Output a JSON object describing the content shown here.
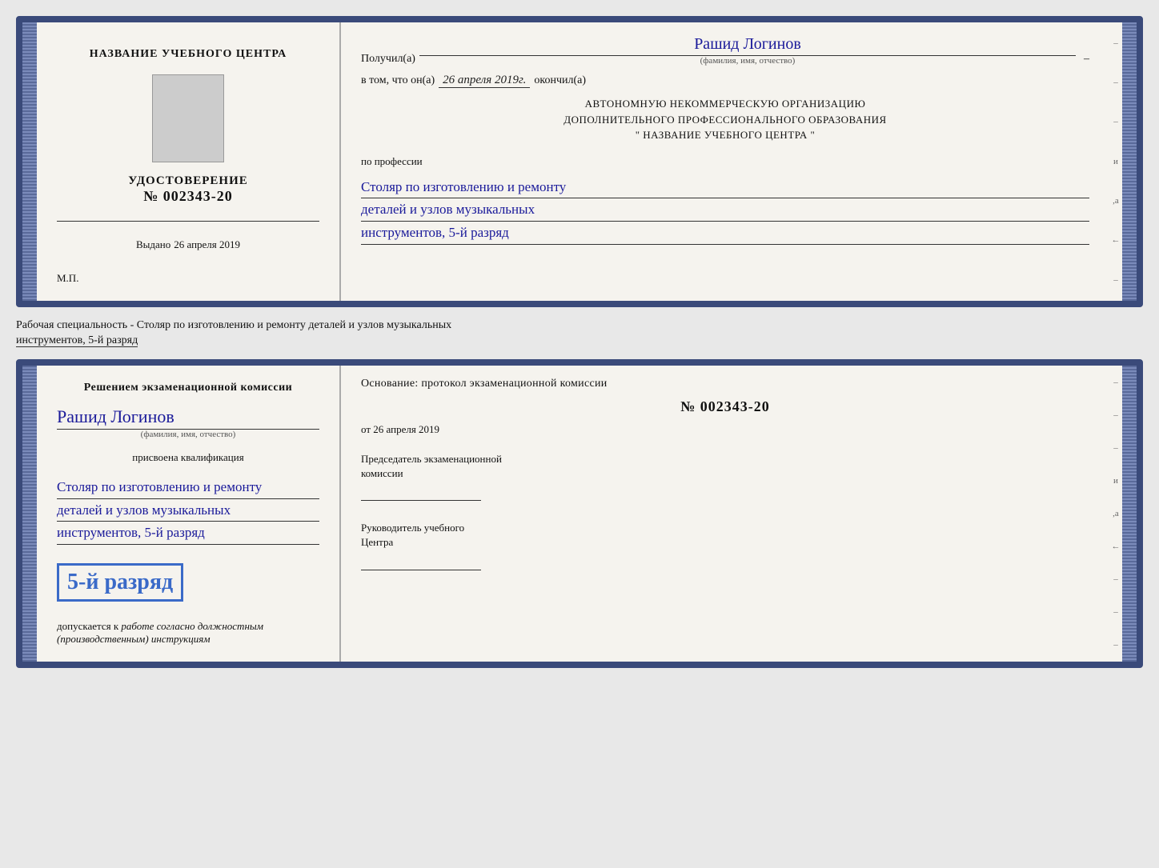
{
  "top_document": {
    "left": {
      "center_name_label": "НАЗВАНИЕ УЧЕБНОГО ЦЕНТРА",
      "udostoverenie_title": "УДОСТОВЕРЕНИЕ",
      "number_prefix": "№",
      "number": "002343-20",
      "vydano_label": "Выдано",
      "vydano_date": "26 апреля 2019",
      "mp_label": "М.П."
    },
    "right": {
      "poluchil_label": "Получил(а)",
      "recipient_name": "Рашид Логинов",
      "fio_subtitle": "(фамилия, имя, отчество)",
      "dash": "–",
      "vtom_prefix": "в том, что он(а)",
      "vtom_date": "26 апреля 2019г.",
      "okonchil_label": "окончил(а)",
      "org_line1": "АВТОНОМНУЮ НЕКОММЕРЧЕСКУЮ ОРГАНИЗАЦИЮ",
      "org_line2": "ДОПОЛНИТЕЛЬНОГО ПРОФЕССИОНАЛЬНОГО ОБРАЗОВАНИЯ",
      "org_line3": "\" НАЗВАНИЕ УЧЕБНОГО ЦЕНТРА \"",
      "po_professii": "по профессии",
      "profession_line1": "Столяр по изготовлению и ремонту",
      "profession_line2": "деталей и узлов музыкальных",
      "profession_line3": "инструментов, 5-й разряд"
    }
  },
  "specialty_label": {
    "prefix": "Рабочая специальность - Столяр по изготовлению и ремонту деталей и узлов музыкальных",
    "line2": "инструментов, 5-й разряд"
  },
  "bottom_document": {
    "left": {
      "resheniem_title": "Решением экзаменационной комиссии",
      "recipient_name": "Рашид Логинов",
      "fio_subtitle": "(фамилия, имя, отчество)",
      "prisvoena_label": "присвоена квалификация",
      "qualification_line1": "Столяр по изготовлению и ремонту",
      "qualification_line2": "деталей и узлов музыкальных",
      "qualification_line3": "инструментов, 5-й разряд",
      "razryad_text": "5-й разряд",
      "dopuskaetsya": "допускается к",
      "dopuskaetsya_handwritten": "работе согласно должностным",
      "dopuskaetsya_handwritten2": "(производственным) инструкциям"
    },
    "right": {
      "osnovanie_label": "Основание: протокол экзаменационной комиссии",
      "number_prefix": "№",
      "protocol_number": "002343-20",
      "ot_prefix": "от",
      "ot_date": "26 апреля 2019",
      "predsedatel_label": "Председатель экзаменационной",
      "predsedatel_label2": "комиссии",
      "rukovoditel_label": "Руководитель учебного",
      "rukovoditel_label2": "Центра"
    }
  },
  "side_chars_top": [
    "–",
    "–",
    "–",
    "–",
    "и",
    ",а",
    "←",
    "–"
  ],
  "side_chars_bottom": [
    "–",
    "–",
    "–",
    "–",
    "и",
    ",а",
    "←",
    "–",
    "–",
    "–"
  ]
}
